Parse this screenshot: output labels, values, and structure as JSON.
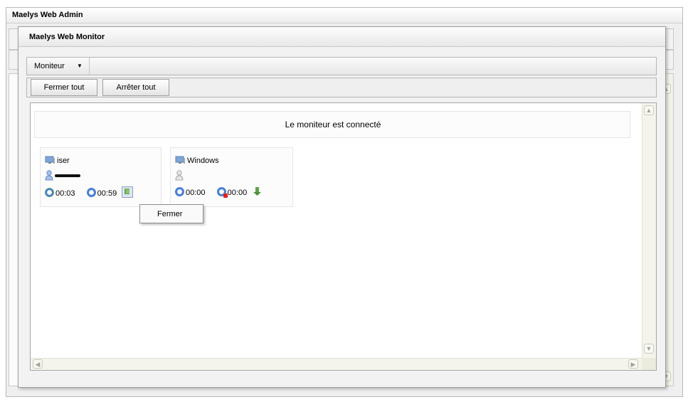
{
  "admin_window": {
    "title": "Maelys Web Admin"
  },
  "monitor_window": {
    "title": "Maelys Web Monitor"
  },
  "menubar": {
    "menu_label": "Moniteur",
    "menu_arrow": "▼"
  },
  "toolbar": {
    "close_all_label": "Fermer tout",
    "stop_all_label": "Arrêter tout"
  },
  "status": {
    "text": "Le moniteur est connecté"
  },
  "sessions": [
    {
      "computer": "iser",
      "user_redacted": true,
      "time_connected": "00:03",
      "time_idle": "00:59",
      "icons": [
        "computer-icon",
        "user-icon",
        "clock-icon",
        "clock-icon",
        "download-icon"
      ]
    },
    {
      "computer": "Windows",
      "user_redacted": false,
      "time_connected": "00:00",
      "time_idle": "00:00",
      "icons": [
        "computer-icon",
        "user-icon",
        "clock-icon",
        "clock-stop-icon",
        "download-icon"
      ]
    }
  ],
  "context_menu": {
    "items": [
      "Fermer"
    ]
  },
  "colors": {
    "accent_blue": "#4a7fd6",
    "accent_green": "#67b047",
    "stop_red": "#e02020",
    "window_bg": "#f2f2f2"
  }
}
